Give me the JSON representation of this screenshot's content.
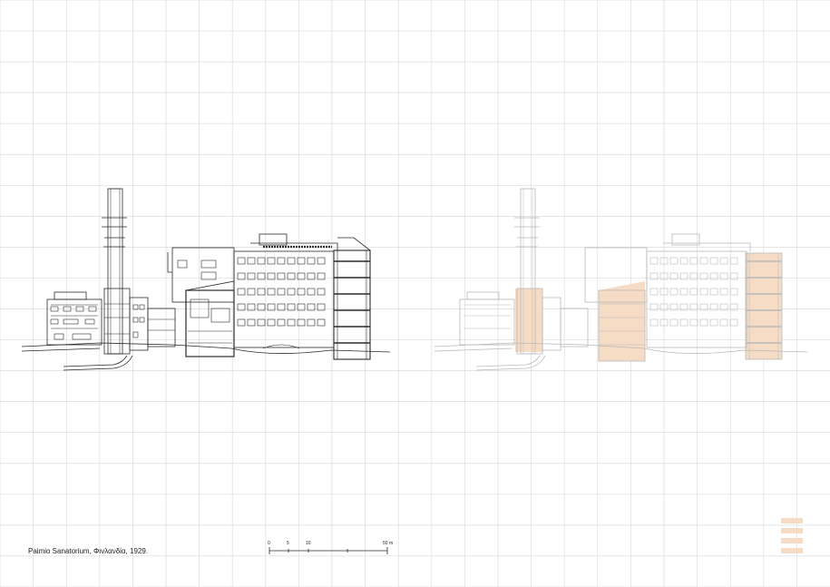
{
  "caption": "Paimio Sanatorium, Φινλανδία, 1929.",
  "scale_bar": {
    "labels": [
      "0",
      "5",
      "10",
      "50 m"
    ]
  },
  "colors": {
    "grid": "#dcdcdc",
    "line": "#2b2b2b",
    "faded_line": "#b9b9b9",
    "highlight": "#f6dcc5"
  },
  "legend_swatch_count": 4
}
